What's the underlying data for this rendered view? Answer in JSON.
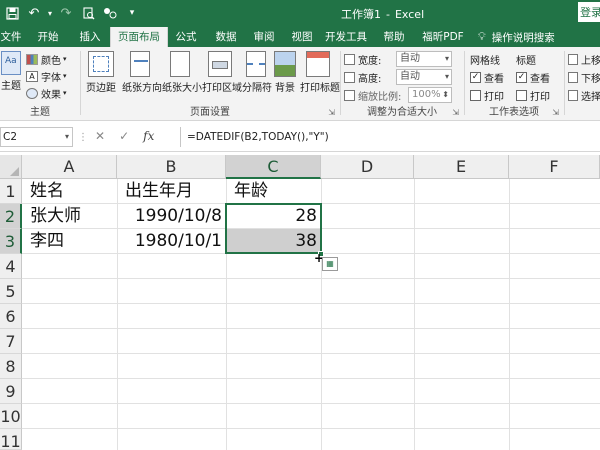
{
  "window": {
    "title": "工作簿1",
    "app": "Excel",
    "signin": "登录",
    "quick_access": [
      "save-icon",
      "undo-icon",
      "redo-icon",
      "print-preview-icon",
      "share-icon",
      "customize-icon"
    ]
  },
  "tabs": [
    "文件",
    "开始",
    "插入",
    "页面布局",
    "公式",
    "数据",
    "审阅",
    "视图",
    "开发工具",
    "帮助",
    "福昕PDF"
  ],
  "active_tab": "页面布局",
  "tell_me": "操作说明搜索",
  "ribbon": {
    "themes": {
      "label": "主题",
      "big_button": "主题",
      "colors": "颜色",
      "fonts": "字体",
      "effects": "效果"
    },
    "page_setup": {
      "label": "页面设置",
      "buttons": [
        "页边距",
        "纸张方向",
        "纸张大小",
        "打印区域",
        "分隔符",
        "背景",
        "打印标题"
      ]
    },
    "scale_to_fit": {
      "label": "调整为合适大小",
      "width_label": "宽度:",
      "width_value": "自动",
      "height_label": "高度:",
      "height_value": "自动",
      "scale_label": "缩放比例:",
      "scale_value": "100%"
    },
    "sheet_options": {
      "label": "工作表选项",
      "gridlines": "网格线",
      "headings": "标题",
      "view": "查看",
      "print": "打印",
      "gridlines_view": true,
      "gridlines_print": false,
      "headings_view": true,
      "headings_print": false
    },
    "arrange": {
      "bring_forward": "上移",
      "send_backward": "下移",
      "selection_pane": "选择"
    }
  },
  "formula_bar": {
    "name_box": "C2",
    "formula": "=DATEDIF(B2,TODAY(),\"Y\")"
  },
  "sheet": {
    "columns": [
      "A",
      "B",
      "C",
      "D",
      "E",
      "F"
    ],
    "selected_column": "C",
    "rows": [
      "1",
      "2",
      "3",
      "4",
      "5",
      "6",
      "7",
      "8",
      "9",
      "10",
      "11"
    ],
    "selected_rows": [
      "2",
      "3"
    ],
    "cells": {
      "A1": "姓名",
      "B1": "出生年月",
      "C1": "年龄",
      "A2": "张大师",
      "B2": "1990/10/8",
      "C2": "28",
      "A3": "李四",
      "B3": "1980/10/1",
      "C3": "38"
    },
    "selection": "C2:C3"
  }
}
